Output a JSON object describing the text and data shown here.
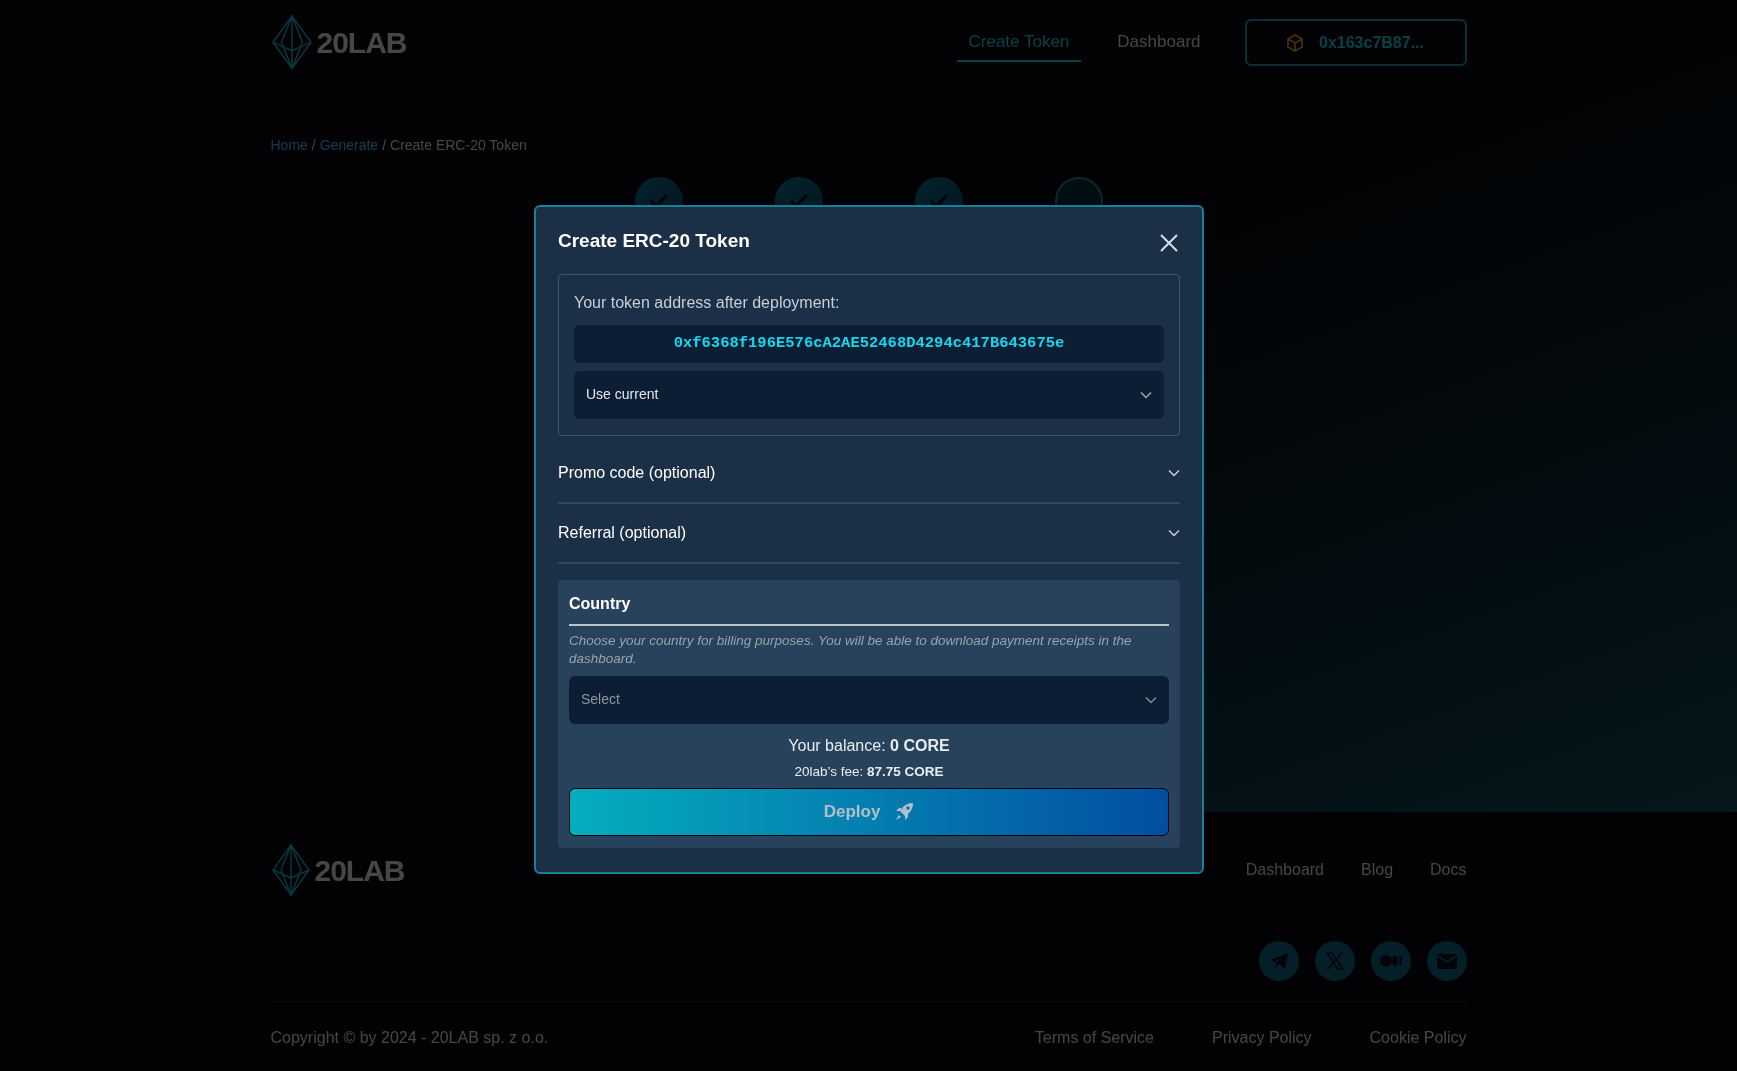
{
  "header": {
    "logo": "20LAB",
    "nav": [
      {
        "label": "Create Token",
        "selected": true
      },
      {
        "label": "Dashboard",
        "selected": false
      }
    ],
    "wallet": "0x163c7B87..."
  },
  "breadcrumb": {
    "separator": "/",
    "items": [
      {
        "label": "Home",
        "link": true
      },
      {
        "label": "Generate",
        "link": true
      },
      {
        "label": "Create ERC-20 Token",
        "link": false
      }
    ]
  },
  "steps": [
    {
      "done": true
    },
    {
      "done": true
    },
    {
      "done": true
    },
    {
      "done": false
    }
  ],
  "modal": {
    "title": "Create ERC-20 Token",
    "address_label": "Your token address after deployment:",
    "address": "0xf6368f196E576cA2AE52468D4294c417B643675e",
    "address_mode": "Use current",
    "sections": [
      {
        "label": "Promo code (optional)",
        "expanded": false
      },
      {
        "label": "Referral (optional)",
        "expanded": false
      }
    ],
    "country": {
      "title": "Country",
      "hint": "Choose your country for billing purposes. You will be able to download payment receipts in the dashboard.",
      "placeholder": "Select"
    },
    "balance": "Your balance: **0 CORE**",
    "fee": "20lab’s fee: **87.75 CORE**",
    "deploy": "Deploy"
  },
  "footer": {
    "logo": "20LAB",
    "links": [
      "Dashboard",
      "Blog",
      "Docs"
    ],
    "socials": [
      {
        "kind": "telegram"
      },
      {
        "kind": "x"
      },
      {
        "kind": "medium"
      },
      {
        "kind": "mail"
      }
    ],
    "copyright": "Copyright © by 2024 - 20LAB sp. z o.o.",
    "legal": [
      "Terms of Service",
      "Privacy Policy",
      "Cookie Policy"
    ]
  }
}
